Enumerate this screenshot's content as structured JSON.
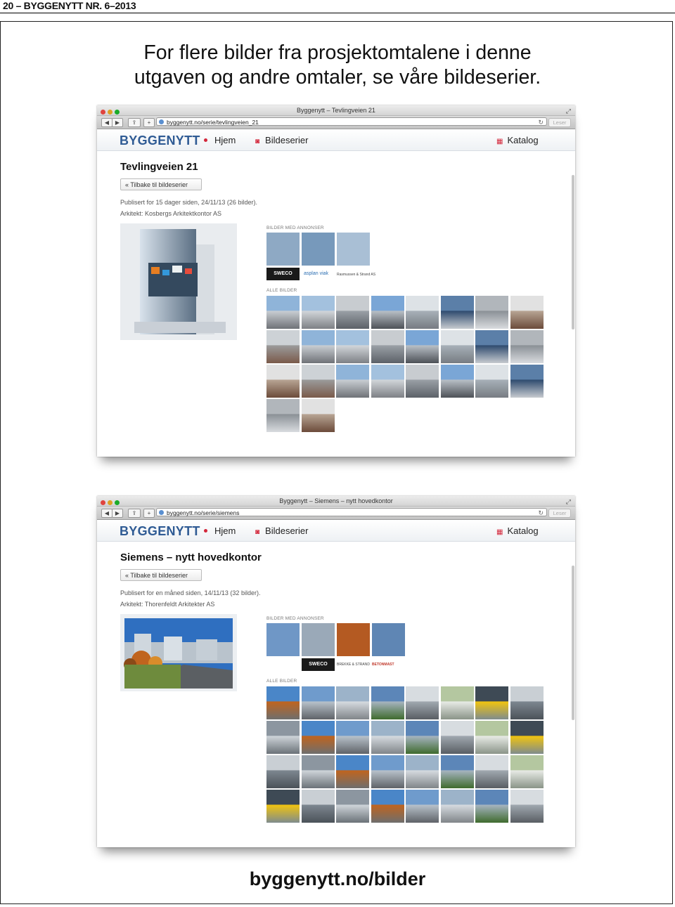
{
  "page_header": {
    "page_number": "20",
    "dash": "–",
    "publication": "BYGGENYTT NR. 6–2013"
  },
  "headline": {
    "line1": "For flere bilder fra prosjektomtalene i denne",
    "line2": "utgaven og andre omtaler, se våre bildeserier."
  },
  "footer": {
    "url": "byggenytt.no/bilder"
  },
  "windows": [
    {
      "window_title": "Byggenytt – Tevlingveien 21",
      "url": "byggenytt.no/serie/tevlingveien_21",
      "reader_label": "Leser",
      "logo": "BYGGENYTT",
      "nav": {
        "home": "Hjem",
        "series": "Bildeserier",
        "catalog": "Katalog"
      },
      "title": "Tevlingveien 21",
      "back_label": "« Tilbake til bildeserier",
      "published": "Publisert for 15 dager siden, 24/11/13 (26 bilder).",
      "architect": "Arkitekt: Kosbergs Arkitektkontor AS",
      "section_ads": "BILDER MED ANNONSER",
      "section_all": "ALLE BILDER",
      "sponsor_logos": [
        "SWECO",
        "asplan viak",
        "Rasmussen & Strand AS"
      ]
    },
    {
      "window_title": "Byggenytt – Siemens – nytt hovedkontor",
      "url": "byggenytt.no/serie/siemens",
      "reader_label": "Leser",
      "logo": "BYGGENYTT",
      "nav": {
        "home": "Hjem",
        "series": "Bildeserier",
        "catalog": "Katalog"
      },
      "title": "Siemens – nytt hovedkontor",
      "back_label": "« Tilbake til bildeserier",
      "published": "Publisert for en måned siden, 14/11/13 (32 bilder).",
      "architect": "Arkitekt: Thorenfeldt Arkitekter AS",
      "section_ads": "BILDER MED ANNONSER",
      "section_all": "ALLE BILDER",
      "sponsor_logos": [
        "SWECO",
        "BREKKE & STRAND",
        "BETONMAST"
      ]
    }
  ],
  "colors": {
    "brand_blue": "#2f5b94",
    "accent_red": "#d3263a"
  }
}
